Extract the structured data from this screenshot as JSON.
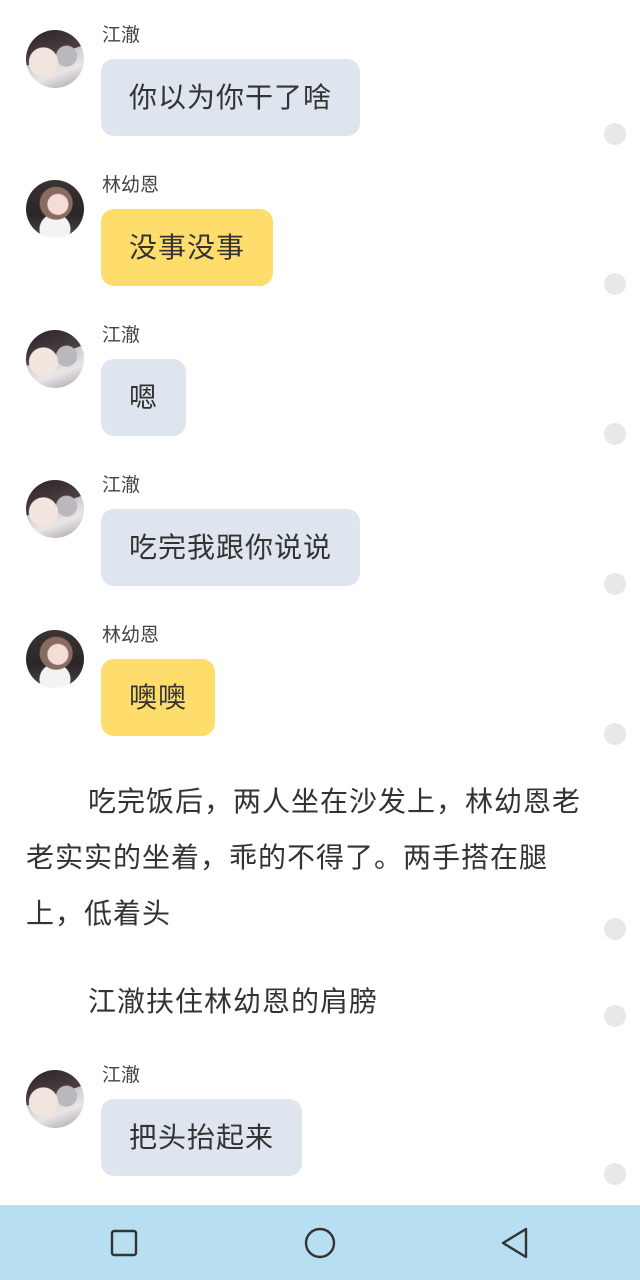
{
  "messages": [
    {
      "sender": "江澈",
      "text": "你以为你干了啥",
      "style": "gray"
    },
    {
      "sender": "林幼恩",
      "text": "没事没事",
      "style": "yellow"
    },
    {
      "sender": "江澈",
      "text": "嗯",
      "style": "gray"
    },
    {
      "sender": "江澈",
      "text": "吃完我跟你说说",
      "style": "gray"
    },
    {
      "sender": "林幼恩",
      "text": "噢噢",
      "style": "yellow"
    },
    {
      "sender": "江澈",
      "text": "把头抬起来",
      "style": "gray"
    }
  ],
  "narration": [
    "吃完饭后，两人坐在沙发上，林幼恩老老实实的坐着，乖的不得了。两手搭在腿上，低着头",
    "江澈扶住林幼恩的肩膀"
  ],
  "colors": {
    "bubble_gray": "#dfe5ee",
    "bubble_yellow": "#fedd6c",
    "navbar": "#b8def2"
  },
  "navbar": {
    "buttons": [
      "recent-apps-icon",
      "home-icon",
      "back-icon"
    ]
  }
}
